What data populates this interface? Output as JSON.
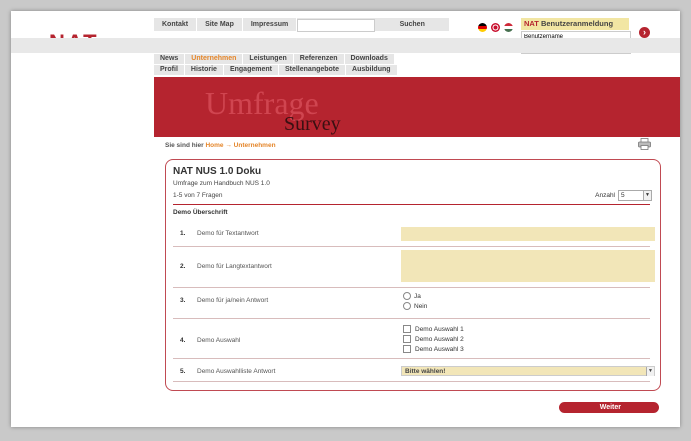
{
  "brand": {
    "logo": "NAT",
    "color": "#b5242f",
    "accent": "#e5862a"
  },
  "topnav": {
    "items": [
      "Kontakt",
      "Site Map",
      "Impressum"
    ],
    "search_label": "Suchen",
    "search_value": ""
  },
  "languages": [
    "flag-de",
    "flag-uk",
    "flag-hu"
  ],
  "login": {
    "title_brand": "NAT",
    "title_text": "Benutzeranmeldung",
    "username_value": "Benutzername",
    "password_value": "•••••••••"
  },
  "nav": {
    "row1": [
      "News",
      "Unternehmen",
      "Leistungen",
      "Referenzen",
      "Downloads"
    ],
    "row2": [
      "Profil",
      "Historie",
      "Engagement",
      "Stellenangebote",
      "Ausbildung"
    ],
    "active": "Unternehmen"
  },
  "banner": {
    "main": "Umfrage",
    "sub": "Survey"
  },
  "breadcrumb": {
    "prefix": "Sie sind hier",
    "home": "Home",
    "arrow": "→",
    "current": "Unternehmen"
  },
  "survey": {
    "title": "NAT NUS 1.0 Doku",
    "subtitle": "Umfrage zum Handbuch NUS 1.0",
    "count": "1-5 von 7 Fragen",
    "anzahl_label": "Anzahl",
    "anzahl_value": "5",
    "section": "Demo Überschrift",
    "questions": [
      {
        "num": "1.",
        "label": "Demo für Textantwort"
      },
      {
        "num": "2.",
        "label": "Demo für Langtextantwort"
      },
      {
        "num": "3.",
        "label": "Demo für ja/nein Antwort",
        "options": [
          "Ja",
          "Nein"
        ]
      },
      {
        "num": "4.",
        "label": "Demo Auswahl",
        "options": [
          "Demo Auswahl 1",
          "Demo Auswahl 2",
          "Demo Auswahl 3"
        ]
      },
      {
        "num": "5.",
        "label": "Demo Auswahlliste Antwort",
        "select_value": "Bitte wählen!"
      }
    ],
    "next_label": "Weiter"
  }
}
